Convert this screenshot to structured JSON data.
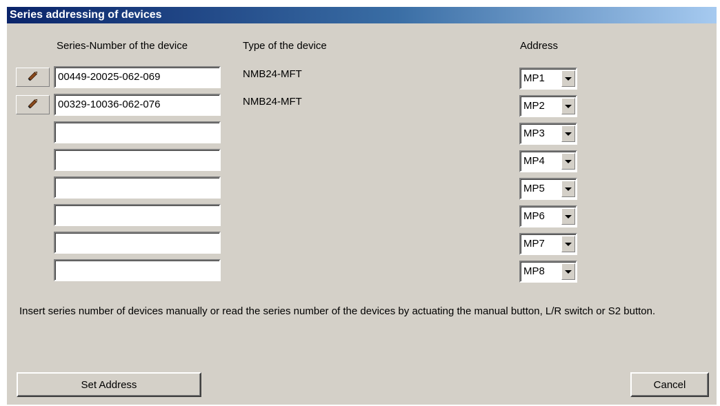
{
  "window": {
    "title": "Series addressing of devices"
  },
  "headers": {
    "serial": "Series-Number of the device",
    "type": "Type of the device",
    "address": "Address"
  },
  "rows": [
    {
      "serial": "00449-20025-062-069",
      "type": "NMB24-MFT",
      "address": "MP1",
      "has_edit_icon": true
    },
    {
      "serial": "00329-10036-062-076",
      "type": "NMB24-MFT",
      "address": "MP2",
      "has_edit_icon": true
    },
    {
      "serial": "",
      "type": "",
      "address": "MP3",
      "has_edit_icon": false
    },
    {
      "serial": "",
      "type": "",
      "address": "MP4",
      "has_edit_icon": false
    },
    {
      "serial": "",
      "type": "",
      "address": "MP5",
      "has_edit_icon": false
    },
    {
      "serial": "",
      "type": "",
      "address": "MP6",
      "has_edit_icon": false
    },
    {
      "serial": "",
      "type": "",
      "address": "MP7",
      "has_edit_icon": false
    },
    {
      "serial": "",
      "type": "",
      "address": "MP8",
      "has_edit_icon": false
    }
  ],
  "info_text": "Insert series number of devices manually or read the series number of the devices by actuating the manual button, L/R switch or S2 button.",
  "buttons": {
    "set_address": "Set Address",
    "cancel": "Cancel"
  },
  "icons": {
    "edit": "pencil-icon",
    "dropdown": "chevron-down-icon"
  },
  "colors": {
    "dialog_bg": "#d4d0c8",
    "title_start": "#0a246a",
    "title_end": "#a6caf0",
    "pencil": "#8b4a1c"
  }
}
